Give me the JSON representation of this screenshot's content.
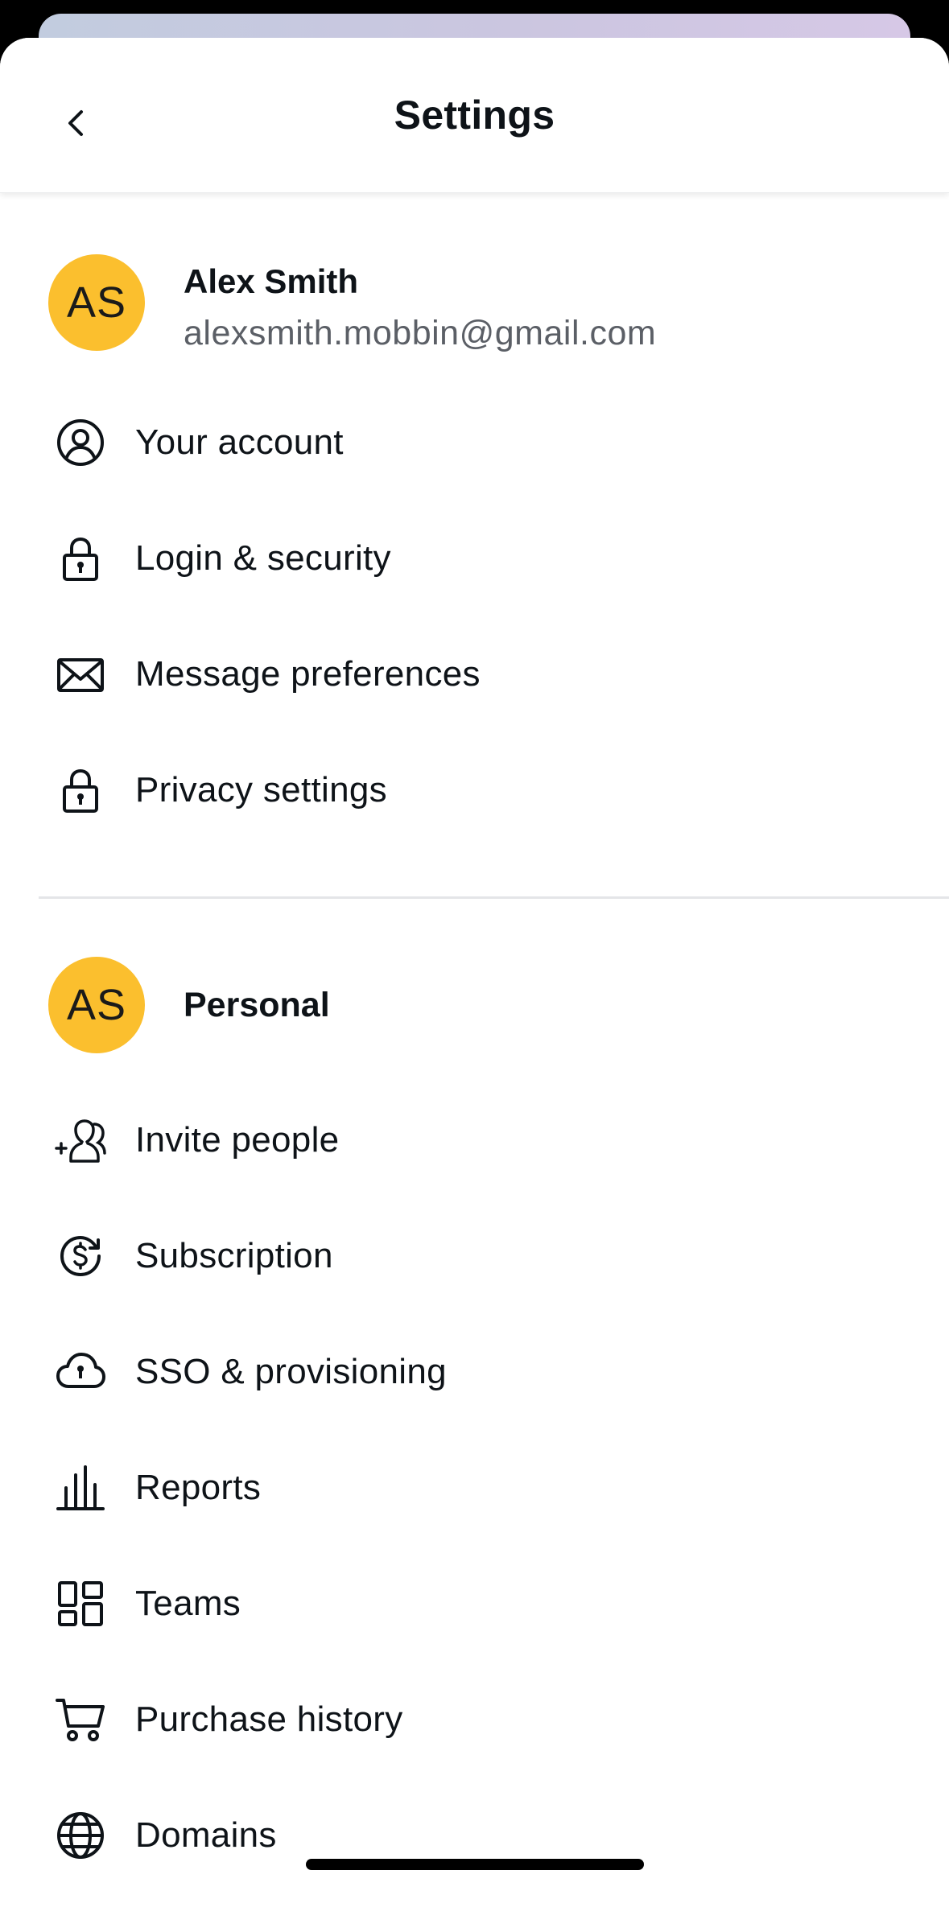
{
  "header": {
    "title": "Settings",
    "back_icon": "chevron-left-icon"
  },
  "profile": {
    "initials": "AS",
    "name": "Alex Smith",
    "email": "alexsmith.mobbin@gmail.com",
    "avatar_color": "#fbbf2e"
  },
  "account_items": [
    {
      "label": "Your account",
      "icon": "user-circle-icon"
    },
    {
      "label": "Login & security",
      "icon": "lock-icon"
    },
    {
      "label": "Message preferences",
      "icon": "envelope-icon"
    },
    {
      "label": "Privacy settings",
      "icon": "lock-icon"
    }
  ],
  "workspace": {
    "initials": "AS",
    "name": "Personal"
  },
  "workspace_items": [
    {
      "label": "Invite people",
      "icon": "add-people-icon"
    },
    {
      "label": "Subscription",
      "icon": "subscription-icon"
    },
    {
      "label": "SSO & provisioning",
      "icon": "cloud-lock-icon"
    },
    {
      "label": "Reports",
      "icon": "bar-chart-icon"
    },
    {
      "label": "Teams",
      "icon": "dashboard-grid-icon"
    },
    {
      "label": "Purchase history",
      "icon": "cart-icon"
    },
    {
      "label": "Domains",
      "icon": "globe-icon"
    }
  ]
}
